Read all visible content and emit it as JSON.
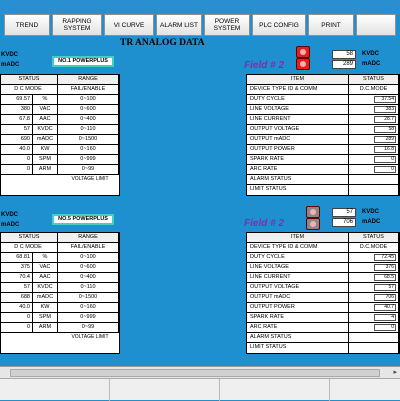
{
  "toolbar": [
    "TREND",
    "RAPPING SYSTEM",
    "VI CURVE",
    "ALARM LIST",
    "POWER SYSTEM",
    "PLC CONFIG",
    "PRINT"
  ],
  "title": "TR ANALOG DATA",
  "left_top": {
    "powerplus": "NO.1 POWERPLUS",
    "kvdc_label": "KVDC",
    "madc_label": "mADC",
    "header": [
      "STATUS",
      "RANGE"
    ],
    "rows": [
      {
        "val": "D C MODE",
        "unit": "",
        "range": "FAIL/ENABLE"
      },
      {
        "val": "69.57",
        "unit": "%",
        "range": "0~100"
      },
      {
        "val": "380",
        "unit": "VAC",
        "range": "0~600"
      },
      {
        "val": "67.8",
        "unit": "AAC",
        "range": "0~400"
      },
      {
        "val": "57",
        "unit": "KVDC",
        "range": "0~110"
      },
      {
        "val": "690",
        "unit": "mADC",
        "range": "0~1500"
      },
      {
        "val": "40.0",
        "unit": "KW",
        "range": "0~160"
      },
      {
        "val": "0",
        "unit": "SPM",
        "range": "0~999"
      },
      {
        "val": "0",
        "unit": "ARM",
        "range": "0~99"
      }
    ],
    "footer": "VOLTAGE LIMIT"
  },
  "left_bottom": {
    "powerplus": "NO.5 POWERPLUS",
    "kvdc_label": "KVDC",
    "madc_label": "mADC",
    "header": [
      "STATUS",
      "RANGE"
    ],
    "rows": [
      {
        "val": "D C MODE",
        "unit": "",
        "range": "FAIL/ENABLE"
      },
      {
        "val": "68.81",
        "unit": "%",
        "range": "0~100"
      },
      {
        "val": "375",
        "unit": "VAC",
        "range": "0~600"
      },
      {
        "val": "70.4",
        "unit": "AAC",
        "range": "0~400"
      },
      {
        "val": "57",
        "unit": "KVDC",
        "range": "0~110"
      },
      {
        "val": "688",
        "unit": "mADC",
        "range": "0~1500"
      },
      {
        "val": "40.0",
        "unit": "KW",
        "range": "0~160"
      },
      {
        "val": "0",
        "unit": "SPM",
        "range": "0~999"
      },
      {
        "val": "0",
        "unit": "ARM",
        "range": "0~99"
      }
    ],
    "footer": "VOLTAGE LIMIT"
  },
  "right_top": {
    "field": "Field # 2",
    "kv": "58",
    "ma": "289",
    "kvdc_label": "KVDC",
    "madc_label": "mADC",
    "header": [
      "ITEM",
      "STATUS"
    ],
    "rows": [
      {
        "item": "DEVICE TYPE ID & COMM",
        "status": "D.C.MODE"
      },
      {
        "item": "DUTY CYCLE",
        "status": "37.54"
      },
      {
        "item": "LINE VOLTAGE",
        "status": "383"
      },
      {
        "item": "LINE CURRENT",
        "status": "28.7"
      },
      {
        "item": "OUTPUT VOLTAGE",
        "status": "58"
      },
      {
        "item": "OUTPUT mADC",
        "status": "289"
      },
      {
        "item": "OUTPUT POWER",
        "status": "16.8"
      },
      {
        "item": "SPARK RATE",
        "status": "0"
      },
      {
        "item": "ARC RATE",
        "status": "0"
      },
      {
        "item": "ALARM STATUS",
        "status": ""
      },
      {
        "item": "LIMIT STATUS",
        "status": ""
      }
    ]
  },
  "right_bottom": {
    "field": "Field # 2",
    "kv": "57",
    "ma": "706",
    "kvdc_label": "KVDC",
    "madc_label": "mADC",
    "header": [
      "ITEM",
      "STATUS"
    ],
    "rows": [
      {
        "item": "DEVICE TYPE ID & COMM",
        "status": "D.C.MODE"
      },
      {
        "item": "DUTY CYCLE",
        "status": "72.45"
      },
      {
        "item": "LINE VOLTAGE",
        "status": "376"
      },
      {
        "item": "LINE CURRENT",
        "status": "68.5"
      },
      {
        "item": "OUTPUT VOLTAGE",
        "status": "57"
      },
      {
        "item": "OUTPUT mADC",
        "status": "706"
      },
      {
        "item": "OUTPUT POWER",
        "status": "40.7"
      },
      {
        "item": "SPARK RATE",
        "status": "4"
      },
      {
        "item": "ARC RATE",
        "status": "0"
      },
      {
        "item": "ALARM STATUS",
        "status": ""
      },
      {
        "item": "LIMIT STATUS",
        "status": ""
      }
    ]
  }
}
